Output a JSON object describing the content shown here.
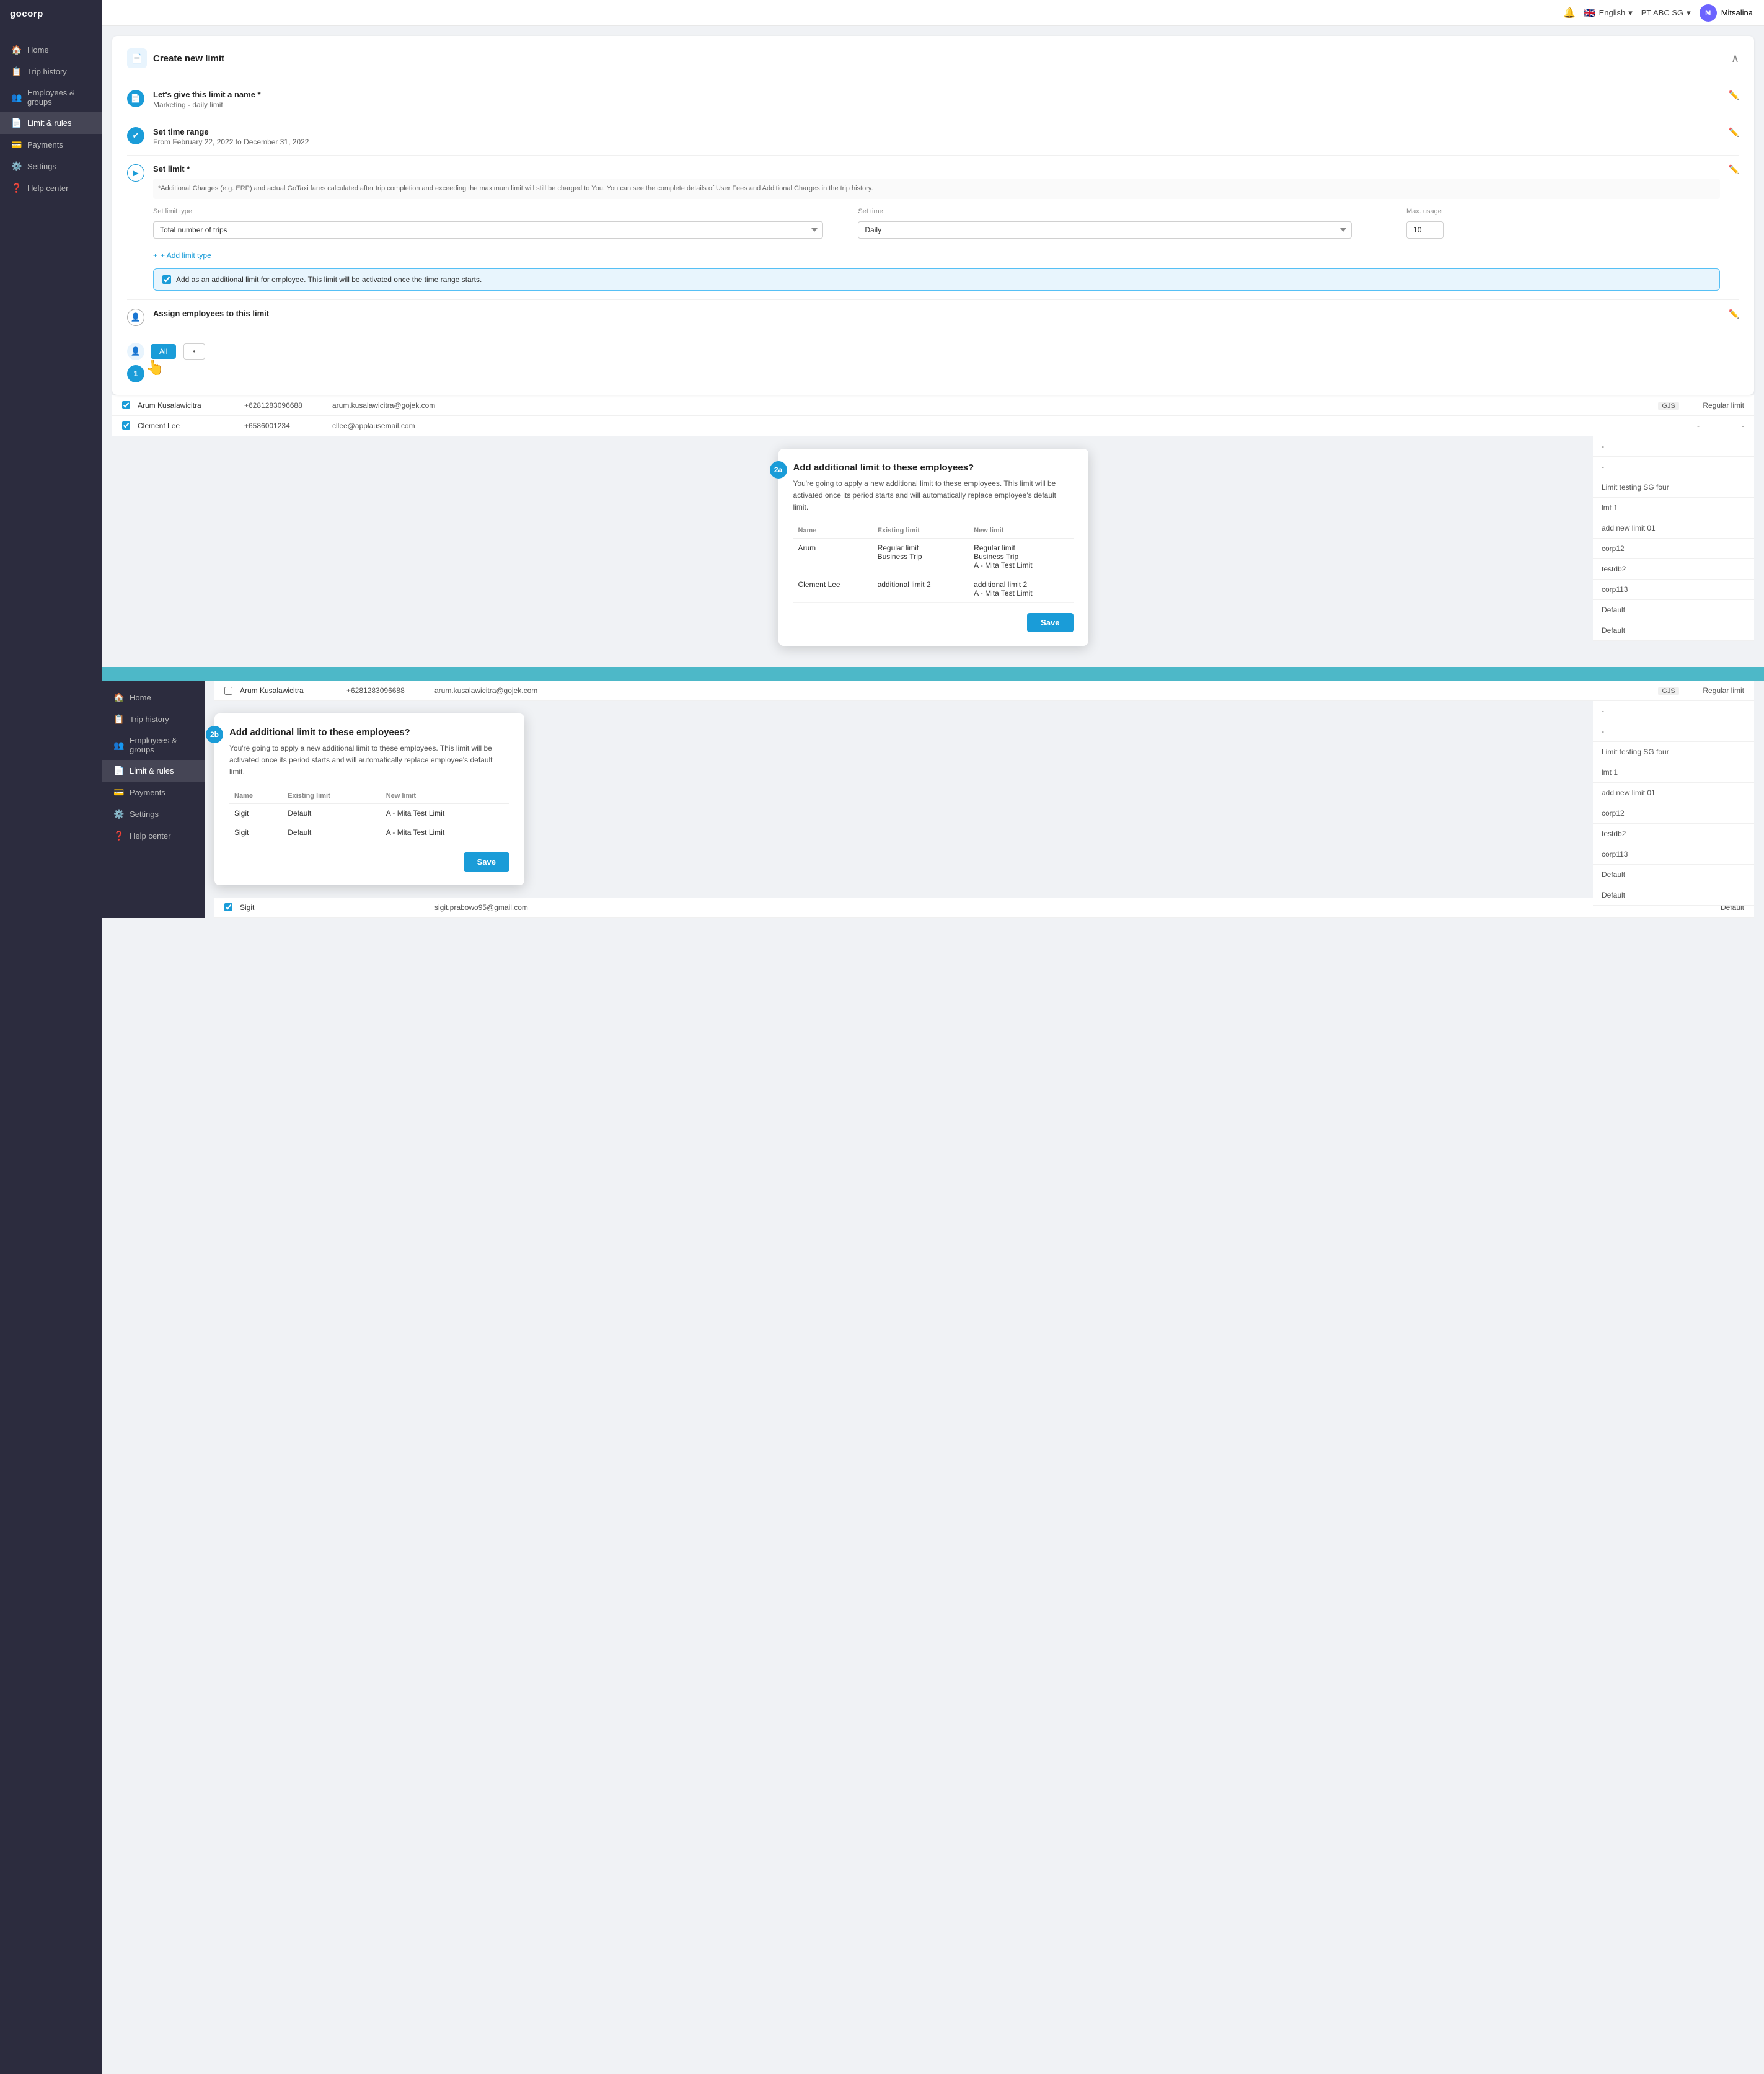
{
  "app": {
    "logo": "gocorp",
    "lang": "English",
    "company": "PT ABC SG",
    "user": "Mitsalina",
    "user_initials": "M"
  },
  "sidebar": {
    "items": [
      {
        "label": "Home",
        "icon": "🏠",
        "active": false
      },
      {
        "label": "Trip history",
        "icon": "📋",
        "active": false
      },
      {
        "label": "Employees & groups",
        "icon": "👥",
        "active": false
      },
      {
        "label": "Limit & rules",
        "icon": "📄",
        "active": true
      },
      {
        "label": "Payments",
        "icon": "💳",
        "active": false
      },
      {
        "label": "Settings",
        "icon": "⚙️",
        "active": false
      },
      {
        "label": "Help center",
        "icon": "❓",
        "active": false
      }
    ]
  },
  "section1": {
    "title": "Create new limit",
    "step_name": {
      "label": "Let's give this limit a name",
      "required": true,
      "value": "Marketing - daily limit"
    },
    "step_time": {
      "label": "Set time range",
      "value": "From February 22, 2022 to December 31, 2022"
    },
    "step_limit": {
      "label": "Set limit",
      "required": true,
      "note": "*Additional Charges (e.g. ERP) and actual GoTaxi fares calculated after trip completion and exceeding the maximum limit will still be charged to You. You can see the complete details of User Fees and Additional Charges in the trip history.",
      "limit_type_label": "Set limit type",
      "limit_type_value": "Total number of trips",
      "set_time_label": "Set time",
      "set_time_value": "Daily",
      "max_usage_label": "Max. usage",
      "max_usage_value": "10",
      "add_limit_btn": "+ Add limit type",
      "checkbox_label": "Add as an additional limit for employee. This limit will be activated once the time range starts."
    },
    "step_employee": {
      "label": "Assign employees to this limit"
    },
    "step1_badge": "1"
  },
  "bg_rows_1": [
    {
      "checked": true,
      "name": "Arum Kusalawicitra",
      "phone": "+6281283096688",
      "email": "arum.kusalawicitra@gojek.com",
      "tag": "GJS",
      "limit": "Regular limit"
    },
    {
      "checked": true,
      "name": "Clement Lee",
      "phone": "+6586001234",
      "email": "cllee@applausemail.com",
      "tag": "-",
      "limit": "-"
    }
  ],
  "bg_rows_right_1": [
    {
      "limit": "Regular limit"
    },
    {
      "limit": "-"
    },
    {
      "limit": "Limit testing SG four"
    },
    {
      "limit": "lmt 1"
    },
    {
      "limit": "add new limit 01"
    },
    {
      "limit": "corp12"
    },
    {
      "limit": "testdb2"
    },
    {
      "limit": "corp113"
    },
    {
      "limit": "Default"
    },
    {
      "limit": "Default"
    }
  ],
  "dialog_2a": {
    "badge": "2a",
    "title": "Add additional limit to these employees?",
    "description": "You're going to apply a new additional limit to these employees. This limit will be activated once its period starts and will automatically replace employee's default limit.",
    "col_name": "Name",
    "col_existing": "Existing limit",
    "col_new": "New limit",
    "rows": [
      {
        "name": "Arum",
        "existing": "Regular limit\nBusiness Trip",
        "existing_lines": [
          "Regular limit",
          "Business Trip"
        ],
        "new_lines": [
          "Regular limit",
          "Business Trip",
          "A - Mita Test Limit"
        ]
      },
      {
        "name": "Clement Lee",
        "existing_lines": [
          "additional limit 2"
        ],
        "new_lines": [
          "additional limit 2",
          "A - Mita Test Limit"
        ]
      }
    ],
    "save_btn": "Save"
  },
  "section2": {
    "sidebar_items": [
      {
        "label": "Home",
        "icon": "🏠"
      },
      {
        "label": "Trip history",
        "icon": "📋"
      },
      {
        "label": "Employees & groups",
        "icon": "👥"
      },
      {
        "label": "Limit & rules",
        "icon": "📄",
        "active": true
      },
      {
        "label": "Payments",
        "icon": "💳"
      },
      {
        "label": "Settings",
        "icon": "⚙️"
      },
      {
        "label": "Help center",
        "icon": "❓"
      }
    ]
  },
  "bg_rows_2": [
    {
      "checked": false,
      "name": "Arum Kusalawicitra",
      "phone": "+6281283096688",
      "email": "arum.kusalawicitra@gojek.com",
      "tag": "GJS",
      "limit": "Regular limit"
    }
  ],
  "bg_rows_right_2": [
    {
      "limit": "-"
    },
    {
      "limit": "-"
    },
    {
      "limit": "Limit testing SG four"
    },
    {
      "limit": "lmt 1"
    },
    {
      "limit": "add new limit 01"
    },
    {
      "limit": "corp12"
    },
    {
      "limit": "testdb2"
    },
    {
      "limit": "corp113"
    },
    {
      "limit": "Default"
    },
    {
      "limit": "Default"
    }
  ],
  "dialog_2b": {
    "badge": "2b",
    "title": "Add additional limit to these employees?",
    "description": "You're going to apply a new additional limit to these employees. This limit will be activated once its period starts and will automatically replace employee's default limit.",
    "col_name": "Name",
    "col_existing": "Existing limit",
    "col_new": "New limit",
    "rows": [
      {
        "name": "Sigit",
        "existing_lines": [
          "Default"
        ],
        "new_lines": [
          "A - Mita Test Limit"
        ]
      },
      {
        "name": "Sigit",
        "existing_lines": [
          "Default"
        ],
        "new_lines": [
          "A - Mita Test Limit"
        ]
      }
    ],
    "save_btn": "Save"
  },
  "last_row": {
    "checked": true,
    "name": "Sigit",
    "email": "sigit.prabowo95@gmail.com",
    "limit": "Default"
  }
}
